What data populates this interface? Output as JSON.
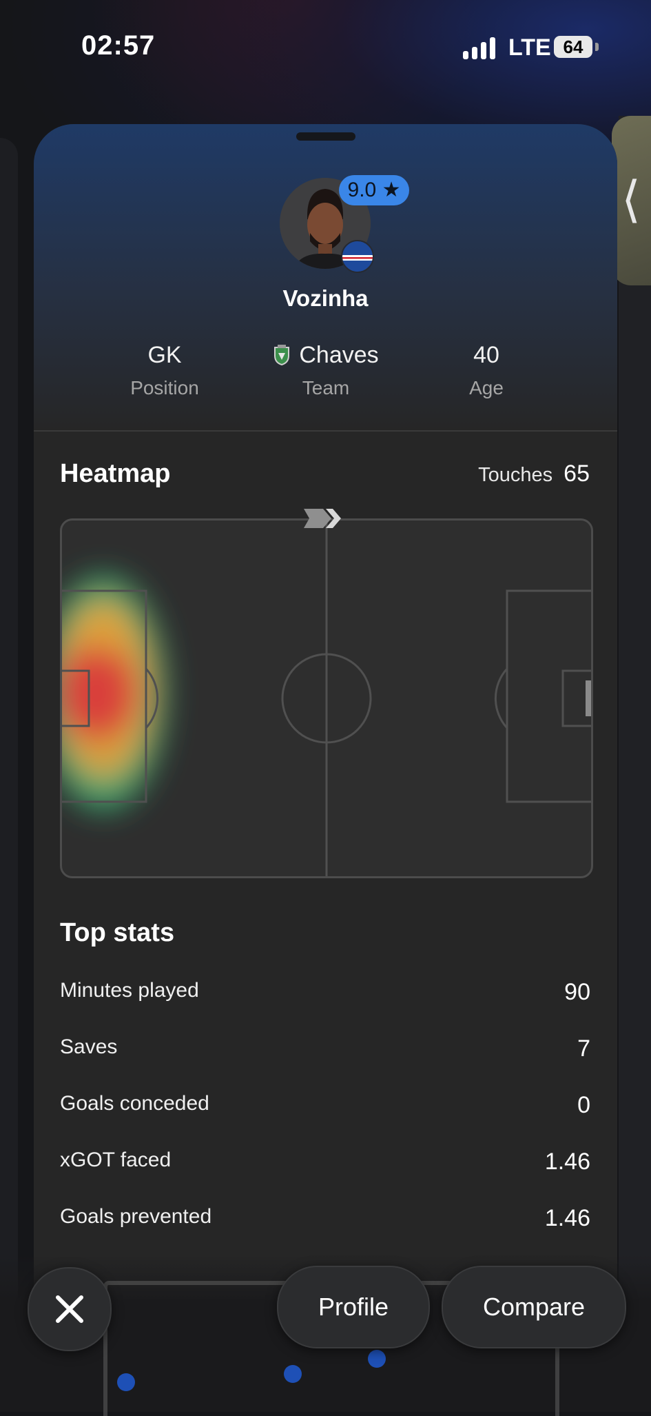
{
  "status_bar": {
    "time": "02:57",
    "network": "LTE",
    "battery": "64"
  },
  "player": {
    "name": "Vozinha",
    "rating": "9.0",
    "position": "GK",
    "position_label": "Position",
    "team": "Chaves",
    "team_label": "Team",
    "age": "40",
    "age_label": "Age"
  },
  "heatmap": {
    "title": "Heatmap",
    "touches_label": "Touches",
    "touches_value": "65"
  },
  "top_stats": {
    "title": "Top stats",
    "rows": [
      {
        "name": "Minutes played",
        "value": "90"
      },
      {
        "name": "Saves",
        "value": "7"
      },
      {
        "name": "Goals conceded",
        "value": "0"
      },
      {
        "name": "xGOT faced",
        "value": "1.46"
      },
      {
        "name": "Goals prevented",
        "value": "1.46"
      }
    ]
  },
  "actions": {
    "profile": "Profile",
    "compare": "Compare"
  },
  "colors": {
    "accent": "#3a86e8",
    "sheet": "#262626",
    "heat_hot": "#d9413b",
    "heat_mid": "#e0a23a",
    "heat_cool": "#3fb87a"
  },
  "icons": {
    "close": "close-icon",
    "rating": "star-icon",
    "direction": "attack-direction-icon",
    "side_tab": "chevron-left-icon"
  }
}
